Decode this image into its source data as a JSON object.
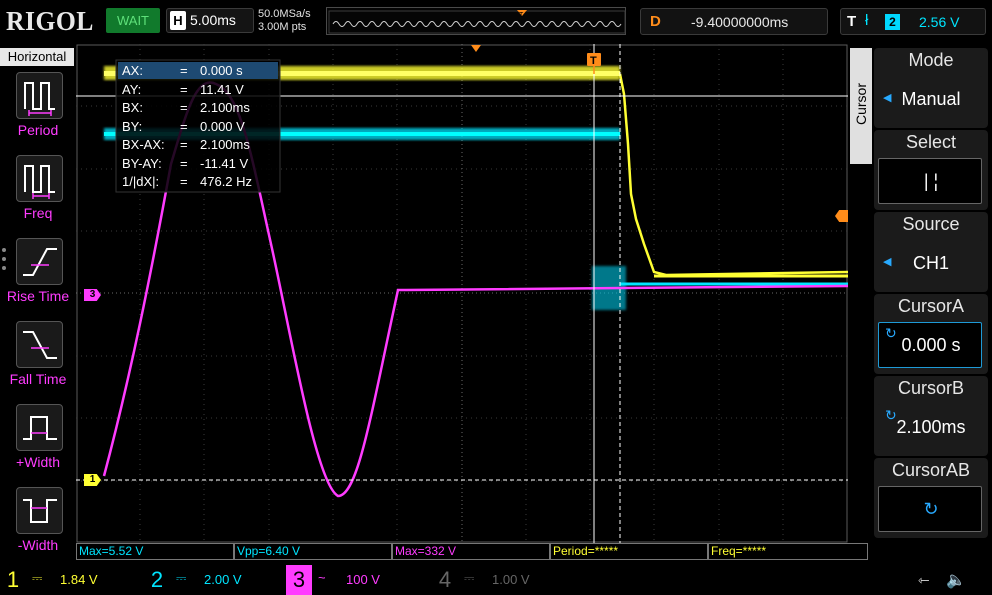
{
  "header": {
    "brand": "RIGOL",
    "run_status": "WAIT",
    "timebase_key": "H",
    "timebase_value": "5.00ms",
    "sample_rate": "50.0MSa/s",
    "memory_depth": "3.00M pts",
    "delay_key": "D",
    "delay_value": "-9.40000000ms",
    "trigger_key": "T",
    "trigger_source": "2",
    "trigger_level": "2.56 V"
  },
  "left_menu": {
    "title": "Horizontal",
    "items": [
      {
        "label": "Period",
        "icon": "period-icon"
      },
      {
        "label": "Freq",
        "icon": "frequency-icon"
      },
      {
        "label": "Rise Time",
        "icon": "rise-time-icon"
      },
      {
        "label": "Fall Time",
        "icon": "fall-time-icon"
      },
      {
        "label": "+Width",
        "icon": "positive-width-icon"
      },
      {
        "label": "-Width",
        "icon": "negative-width-icon"
      }
    ]
  },
  "cursor_readout": {
    "rows": [
      {
        "key": "AX:",
        "eq": "=",
        "value": "0.000 s"
      },
      {
        "key": "AY:",
        "eq": "=",
        "value": "11.41 V"
      },
      {
        "key": "BX:",
        "eq": "=",
        "value": "2.100ms"
      },
      {
        "key": "BY:",
        "eq": "=",
        "value": "0.000 V"
      },
      {
        "key": "BX-AX:",
        "eq": "=",
        "value": "2.100ms"
      },
      {
        "key": "BY-AY:",
        "eq": "=",
        "value": "-11.41 V"
      },
      {
        "key": "1/|dX|:",
        "eq": "=",
        "value": "476.2 Hz"
      }
    ]
  },
  "right_menu": {
    "title": "Cursor",
    "mode_label": "Mode",
    "mode_value": "Manual",
    "select_label": "Select",
    "select_value": "| ¦",
    "source_label": "Source",
    "source_value": "CH1",
    "cursor_a_label": "CursorA",
    "cursor_a_value": "0.000 s",
    "cursor_b_label": "CursorB",
    "cursor_b_value": "2.100ms",
    "cursor_ab_label": "CursorAB"
  },
  "markers": {
    "ch1": "1",
    "ch3": "3",
    "trigger": "T"
  },
  "measurements": [
    {
      "text": "Max=5.52 V",
      "color": "#00e5ff"
    },
    {
      "text": "Vpp=6.40 V",
      "color": "#00e5ff"
    },
    {
      "text": "Max=332 V",
      "color": "#ff3cff"
    },
    {
      "text": "Period=*****",
      "color": "#ffff33"
    },
    {
      "text": "Freq=*****",
      "color": "#ffff33"
    }
  ],
  "channels": [
    {
      "num": "1",
      "coupling": "⎓",
      "scale": "1.84 V",
      "color": "#ffff33",
      "active": true
    },
    {
      "num": "2",
      "coupling": "⎓",
      "scale": "2.00 V",
      "color": "#00e5ff",
      "active": true
    },
    {
      "num": "3",
      "coupling": "~",
      "scale": "100 V",
      "color": "#ff3cff",
      "active": true,
      "highlight": true
    },
    {
      "num": "4",
      "coupling": "⎓",
      "scale": "1.00 V",
      "color": "#555555",
      "active": false
    }
  ],
  "colors": {
    "ch1": "#ffff33",
    "ch2": "#00e5ff",
    "ch3": "#ff3cff",
    "accent": "#ff8c1a",
    "menu_highlight": "#1e9ad6"
  }
}
